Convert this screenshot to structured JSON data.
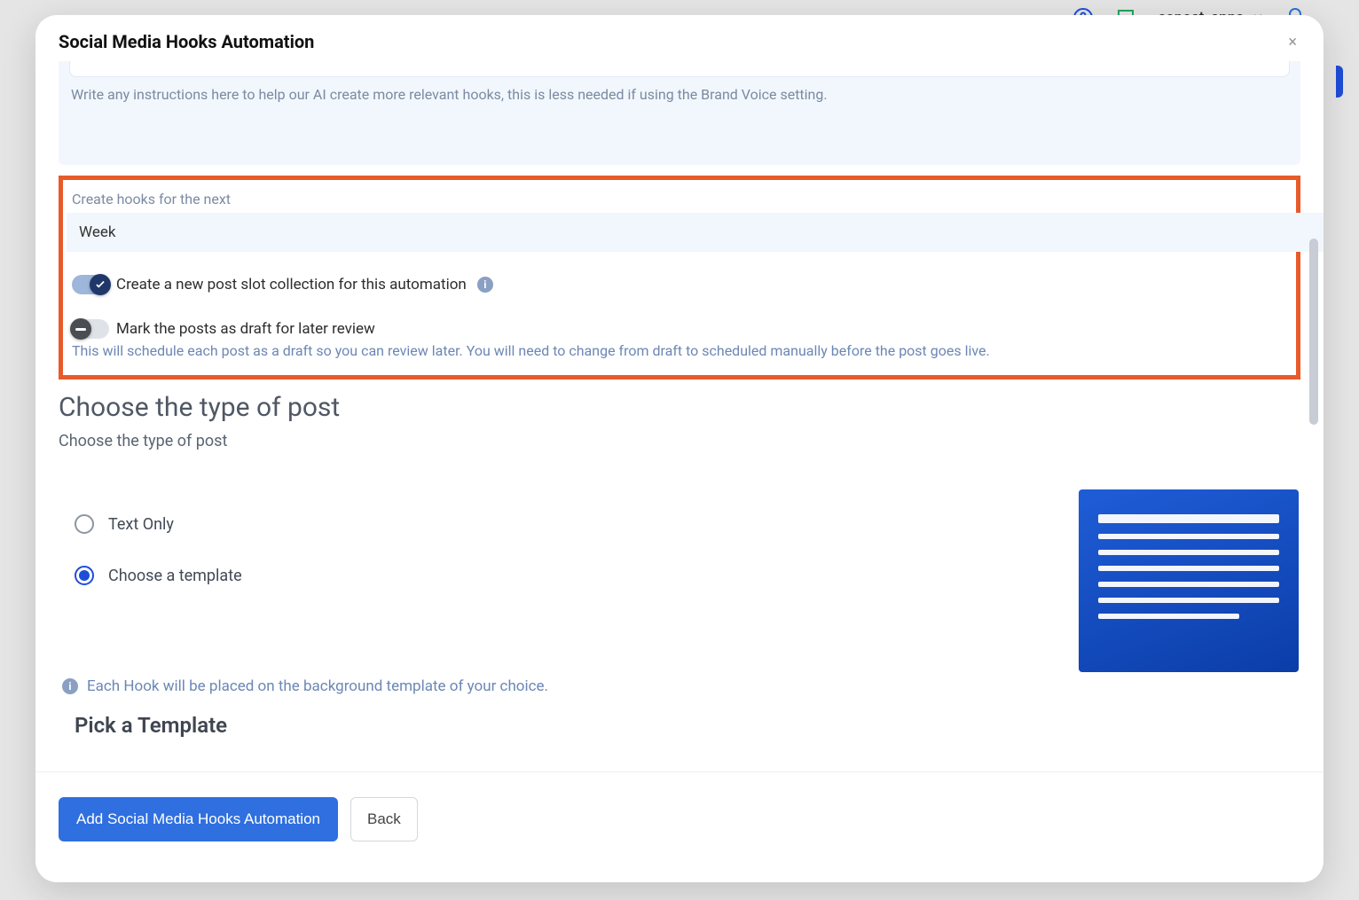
{
  "header": {
    "account_name": "copost_apps"
  },
  "modal": {
    "title": "Social Media Hooks Automation",
    "hint": "Write any instructions here to help our AI create more relevant hooks, this is less needed if using the Brand Voice setting.",
    "period_label": "Create hooks for the next",
    "period_value": "Week",
    "toggle1_label": "Create a new post slot collection for this automation",
    "toggle2_label": "Mark the posts as draft for later review",
    "toggle2_desc": "This will schedule each post as a draft so you can review later. You will need to change from draft to scheduled manually before the post goes live.",
    "section_title": "Choose the type of post",
    "section_sub": "Choose the type of post",
    "radios": {
      "text_only": "Text Only",
      "choose_template": "Choose a template"
    },
    "template_hint": "Each Hook will be placed on the background template of your choice.",
    "pick_template": "Pick a Template",
    "primary_button": "Add Social Media Hooks Automation",
    "back_button": "Back"
  }
}
